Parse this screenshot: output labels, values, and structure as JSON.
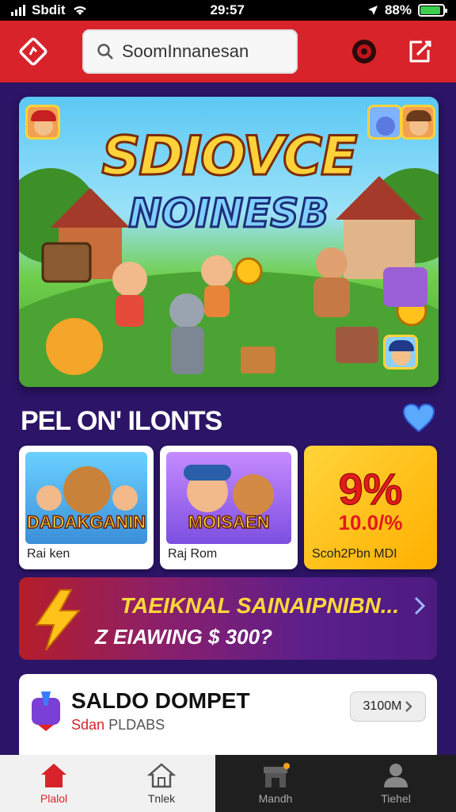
{
  "status_bar": {
    "carrier": "Sbdit",
    "time": "29:57",
    "battery": "88%",
    "battery_level": 0.88
  },
  "header": {
    "search_text": "SoomInnanesan"
  },
  "banner": {
    "title_line1": "SDIOVCE",
    "title_line2": "NOINESB"
  },
  "section": {
    "title": "PEL ON' ILONTS"
  },
  "cards": [
    {
      "label": "Rai ken",
      "art_title": "DADAKGANIN"
    },
    {
      "label": "Raj Rom",
      "art_title": "MOISAEN"
    },
    {
      "label": "Scoh2Pbn MDI",
      "promo_big": "9%",
      "promo_small": "10.0/%"
    }
  ],
  "promo_strip": {
    "line1": "TAEIKNAL SAINAIPNIBN...",
    "line2": "Z EIAWING $ 300?"
  },
  "wallet": {
    "title": "SALDO DOMPET",
    "subtitle_red": "Sdan",
    "subtitle": "PLDABS",
    "button": "3100M"
  },
  "bottom_nav": [
    {
      "label": "Plalol",
      "icon": "home-icon"
    },
    {
      "label": "Tnlek",
      "icon": "house-outline-icon"
    },
    {
      "label": "Mandh",
      "icon": "store-icon"
    },
    {
      "label": "Tiehel",
      "icon": "profile-icon"
    }
  ],
  "colors": {
    "brand_red": "#d8232a",
    "background_purple": "#2c1466",
    "accent_yellow": "#ffd23a"
  }
}
